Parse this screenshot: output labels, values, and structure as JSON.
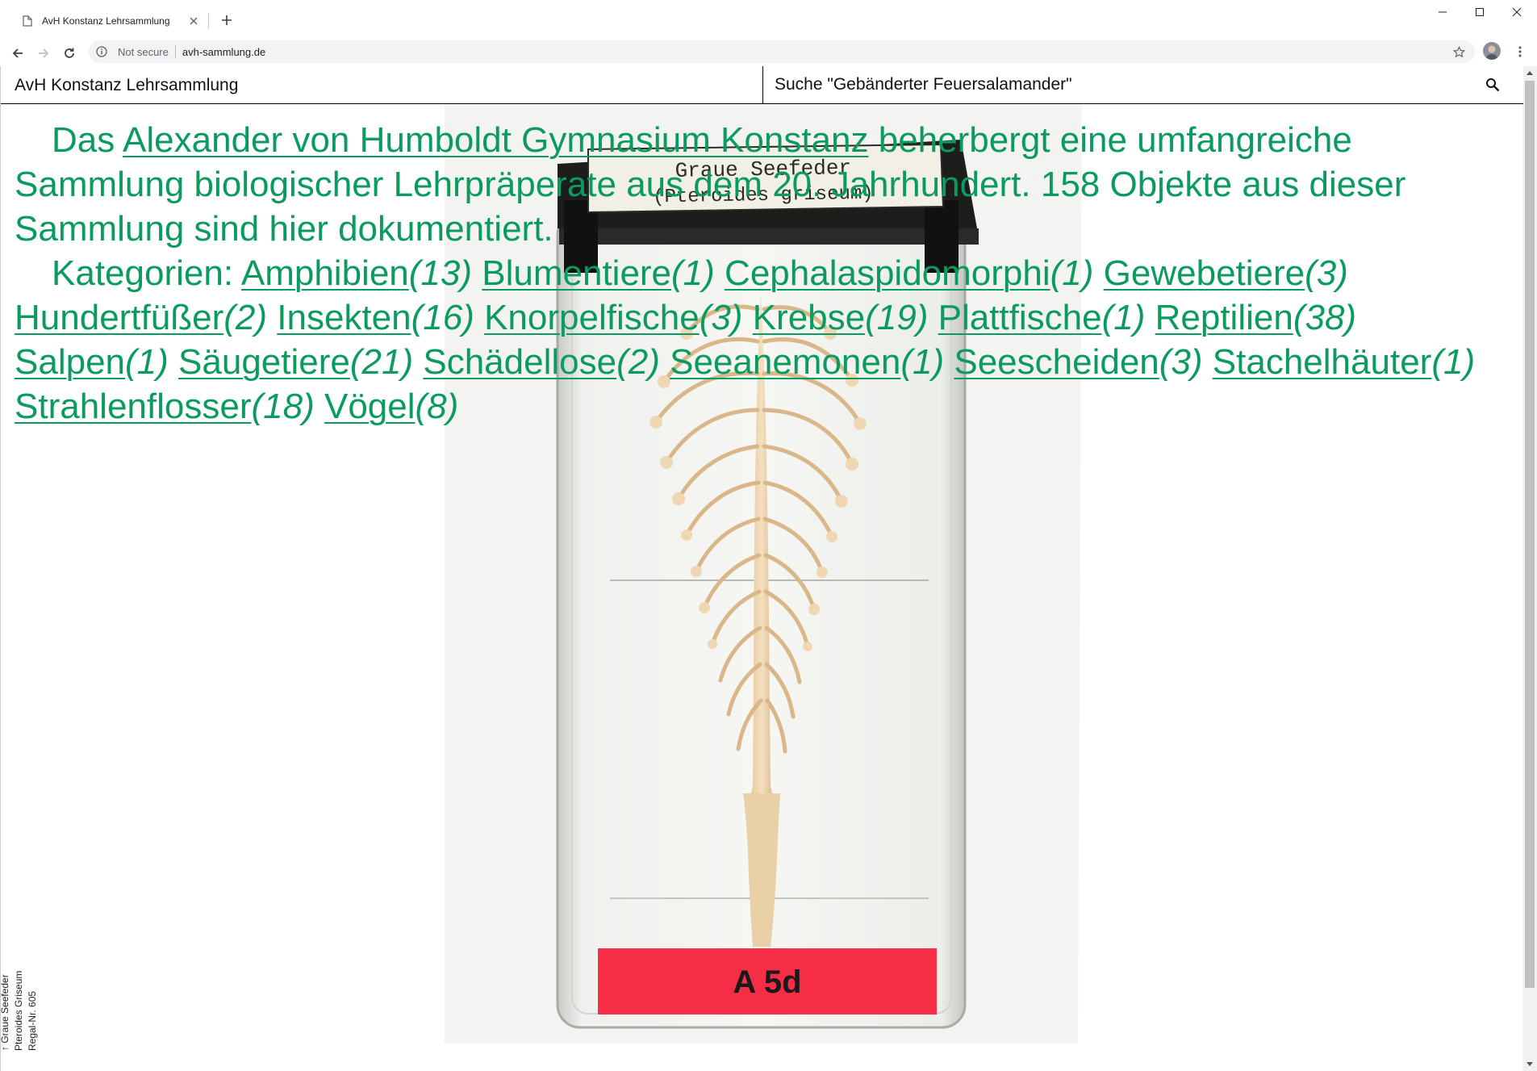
{
  "browser": {
    "tab": {
      "title": "AvH Konstanz Lehrsammlung",
      "icon": "document-icon"
    },
    "toolbar": {
      "security_label": "Not secure",
      "url": "avh-sammlung.de"
    },
    "controls": {
      "minimize": "—",
      "maximize": "▢",
      "close": "✕"
    }
  },
  "header": {
    "site_title": "AvH Konstanz Lehrsammlung",
    "search": {
      "placeholder": "Suche \"Gebänderter Feuersalamander\""
    }
  },
  "intro": {
    "lead_before": "Das ",
    "school_link": "Alexander von Humboldt Gymnasium Konstanz",
    "lead_after": " beherbergt eine umfangreiche Sammlung biologischer Lehrpräperate aus dem 20. Jahrhundert. 158 Objekte aus dieser Sammlung sind hier dokumentiert.",
    "categories_label": "Kategorien: ",
    "categories": [
      {
        "name": "Amphibien",
        "count": "(13)"
      },
      {
        "name": "Blumentiere",
        "count": "(1)"
      },
      {
        "name": "Cephalaspidomorphi",
        "count": "(1)"
      },
      {
        "name": "Gewebetiere",
        "count": "(3)"
      },
      {
        "name": "Hundertfüßer",
        "count": "(2)"
      },
      {
        "name": "Insekten",
        "count": "(16)"
      },
      {
        "name": "Knorpelfische",
        "count": "(3)"
      },
      {
        "name": "Krebse",
        "count": "(19)"
      },
      {
        "name": "Plattfische",
        "count": "(1)"
      },
      {
        "name": "Reptilien",
        "count": "(38)"
      },
      {
        "name": "Salpen",
        "count": "(1)"
      },
      {
        "name": "Säugetiere",
        "count": "(21)"
      },
      {
        "name": "Schädellose",
        "count": "(2)"
      },
      {
        "name": "Seeanemonen",
        "count": "(1)"
      },
      {
        "name": "Seescheiden",
        "count": "(3)"
      },
      {
        "name": "Stachelhäuter",
        "count": "(1)"
      },
      {
        "name": "Strahlenflosser",
        "count": "(18)"
      },
      {
        "name": "Vögel",
        "count": "(8)"
      }
    ]
  },
  "specimen": {
    "jar_label_line1": "Graue Seefeder",
    "jar_label_line2": "(Pteroides griseum)",
    "shelf_tag": "A 5d"
  },
  "caption": {
    "arrow": "↑",
    "common_name": "Graue Seefeder",
    "latin_name": "Pteroides Griseum",
    "shelf_no": "Regal-Nr. 605"
  },
  "colors": {
    "accent_green": "#0b9b5e",
    "tag_red": "#f52e45"
  }
}
